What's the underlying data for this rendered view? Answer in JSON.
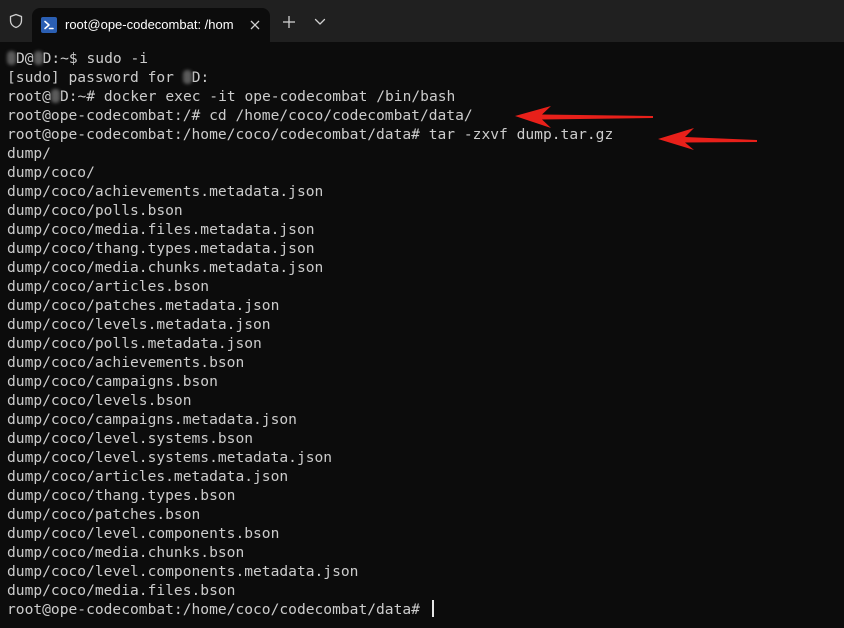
{
  "titlebar": {
    "tab_title": "root@ope-codecombat: /hom",
    "icons": {
      "shield": "shield-icon",
      "tab": "powershell-icon",
      "close": "close-icon",
      "new_tab": "plus-icon",
      "dropdown": "chevron-down-icon"
    }
  },
  "terminal": {
    "lines": [
      {
        "segments": [
          {
            "blur": true
          },
          {
            "text": "D@"
          },
          {
            "blur": true
          },
          {
            "text": "D:~$ sudo -i"
          }
        ]
      },
      {
        "segments": [
          {
            "text": "[sudo] password for "
          },
          {
            "blur": true
          },
          {
            "text": "D:"
          }
        ]
      },
      {
        "segments": [
          {
            "text": "root@"
          },
          {
            "blur": true
          },
          {
            "text": "D:~# docker exec -it ope-codecombat /bin/bash"
          }
        ]
      },
      {
        "segments": [
          {
            "text": "root@ope-codecombat:/# cd /home/coco/codecombat/data/"
          }
        ]
      },
      {
        "segments": [
          {
            "text": "root@ope-codecombat:/home/coco/codecombat/data# tar -zxvf dump.tar.gz"
          }
        ]
      },
      {
        "segments": [
          {
            "text": "dump/"
          }
        ]
      },
      {
        "segments": [
          {
            "text": "dump/coco/"
          }
        ]
      },
      {
        "segments": [
          {
            "text": "dump/coco/achievements.metadata.json"
          }
        ]
      },
      {
        "segments": [
          {
            "text": "dump/coco/polls.bson"
          }
        ]
      },
      {
        "segments": [
          {
            "text": "dump/coco/media.files.metadata.json"
          }
        ]
      },
      {
        "segments": [
          {
            "text": "dump/coco/thang.types.metadata.json"
          }
        ]
      },
      {
        "segments": [
          {
            "text": "dump/coco/media.chunks.metadata.json"
          }
        ]
      },
      {
        "segments": [
          {
            "text": "dump/coco/articles.bson"
          }
        ]
      },
      {
        "segments": [
          {
            "text": "dump/coco/patches.metadata.json"
          }
        ]
      },
      {
        "segments": [
          {
            "text": "dump/coco/levels.metadata.json"
          }
        ]
      },
      {
        "segments": [
          {
            "text": "dump/coco/polls.metadata.json"
          }
        ]
      },
      {
        "segments": [
          {
            "text": "dump/coco/achievements.bson"
          }
        ]
      },
      {
        "segments": [
          {
            "text": "dump/coco/campaigns.bson"
          }
        ]
      },
      {
        "segments": [
          {
            "text": "dump/coco/levels.bson"
          }
        ]
      },
      {
        "segments": [
          {
            "text": "dump/coco/campaigns.metadata.json"
          }
        ]
      },
      {
        "segments": [
          {
            "text": "dump/coco/level.systems.bson"
          }
        ]
      },
      {
        "segments": [
          {
            "text": "dump/coco/level.systems.metadata.json"
          }
        ]
      },
      {
        "segments": [
          {
            "text": "dump/coco/articles.metadata.json"
          }
        ]
      },
      {
        "segments": [
          {
            "text": "dump/coco/thang.types.bson"
          }
        ]
      },
      {
        "segments": [
          {
            "text": "dump/coco/patches.bson"
          }
        ]
      },
      {
        "segments": [
          {
            "text": "dump/coco/level.components.bson"
          }
        ]
      },
      {
        "segments": [
          {
            "text": "dump/coco/media.chunks.bson"
          }
        ]
      },
      {
        "segments": [
          {
            "text": "dump/coco/level.components.metadata.json"
          }
        ]
      },
      {
        "segments": [
          {
            "text": "dump/coco/media.files.bson"
          }
        ]
      },
      {
        "segments": [
          {
            "text": "root@ope-codecombat:/home/coco/codecombat/data# "
          }
        ],
        "cursor": true
      }
    ]
  },
  "colors": {
    "background": "#0c0c0c",
    "titlebar": "#202020",
    "text": "#cccccc",
    "annotation_arrow": "#e8201a"
  }
}
